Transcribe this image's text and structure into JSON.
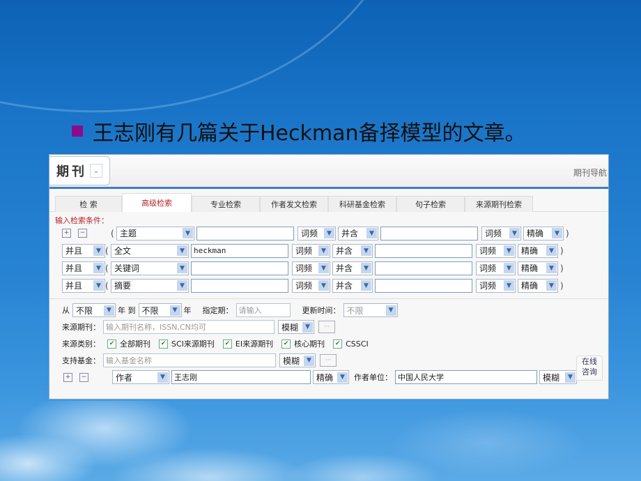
{
  "slide": {
    "title": "王志刚有几篇关于Heckman备择模型的文章。",
    "bullet_color": "#8b0c8a"
  },
  "app": {
    "database_select": "期刊",
    "nav_link": "期刊导航",
    "tabs": [
      {
        "label": "检 索",
        "active": false
      },
      {
        "label": "高级检索",
        "active": true
      },
      {
        "label": "专业检索",
        "active": false
      },
      {
        "label": "作者发文检索",
        "active": false
      },
      {
        "label": "科研基金检索",
        "active": false
      },
      {
        "label": "句子检索",
        "active": false
      },
      {
        "label": "来源期刊检索",
        "active": false
      }
    ],
    "conditions_label": "输入检索条件：",
    "condition_rows": [
      {
        "logic": "",
        "field": "主题",
        "term1": "",
        "freq1": "词频",
        "relation": "并含",
        "term2": "",
        "freq2": "词频",
        "match": "精确"
      },
      {
        "logic": "并且",
        "field": "全文",
        "term1": "heckman",
        "freq1": "词频",
        "relation": "并含",
        "term2": "",
        "freq2": "词频",
        "match": "精确"
      },
      {
        "logic": "并且",
        "field": "关键词",
        "term1": "",
        "freq1": "词频",
        "relation": "并含",
        "term2": "",
        "freq2": "词频",
        "match": "精确"
      },
      {
        "logic": "并且",
        "field": "摘要",
        "term1": "",
        "freq1": "词频",
        "relation": "并含",
        "term2": "",
        "freq2": "词频",
        "match": "精确"
      }
    ],
    "open_paren": "(",
    "close_paren": ")",
    "date": {
      "from_label": "从",
      "from_value": "不限",
      "year_to_label": "年 到",
      "to_value": "不限",
      "year_label": "年",
      "period_label": "指定期：",
      "period_placeholder": "请输入",
      "update_label": "更新时间：",
      "update_value": "不限"
    },
    "source": {
      "label": "来源期刊：",
      "placeholder": "输入期刊名称，ISSN,CN均可",
      "match": "模糊",
      "more": "···"
    },
    "category": {
      "label": "来源类别：",
      "options": [
        {
          "label": "全部期刊",
          "checked": true
        },
        {
          "label": "SCI来源期刊",
          "checked": true
        },
        {
          "label": "EI来源期刊",
          "checked": true
        },
        {
          "label": "核心期刊",
          "checked": true
        },
        {
          "label": "CSSCI",
          "checked": true
        }
      ]
    },
    "fund": {
      "label": "支持基金：",
      "placeholder": "输入基金名称",
      "match": "模糊",
      "more": "···"
    },
    "author": {
      "field": "作者",
      "value": "王志刚",
      "match": "精确",
      "unit_label": "作者单位：",
      "unit_value": "中国人民大学",
      "unit_match": "模糊"
    },
    "consult": {
      "line1": "在线",
      "line2": "咨询"
    }
  }
}
